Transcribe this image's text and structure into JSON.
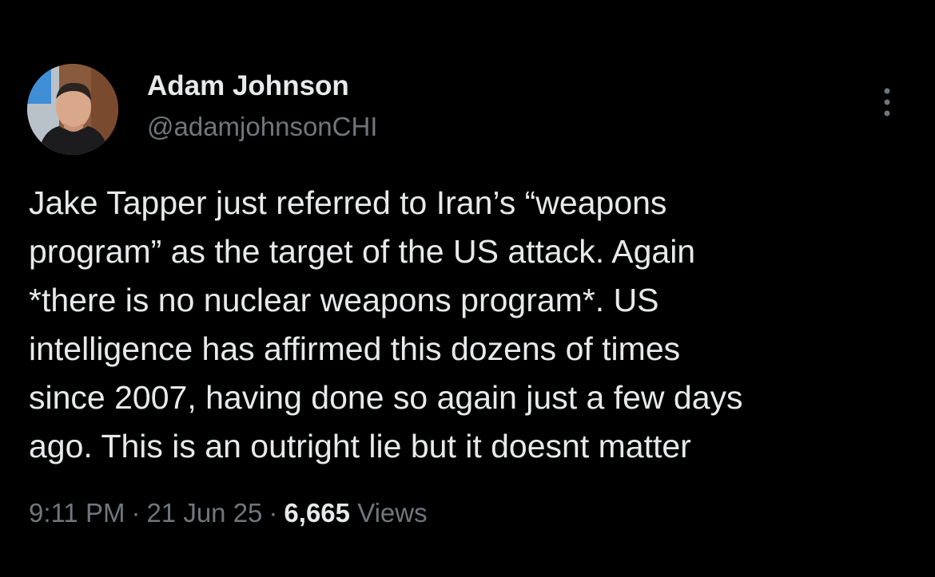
{
  "author": {
    "display_name": "Adam Johnson",
    "handle": "@adamjohnsonCHI",
    "avatar_icon": "profile-photo"
  },
  "tweet": {
    "text": "Jake Tapper just referred to Iran’s “weapons\nprogram” as the target of the US attack. Again\n*there is no nuclear weapons program*. US\nintelligence has affirmed this dozens of times\nsince 2007, having done so again just a few days\nago. This is an outright lie but it doesnt matter"
  },
  "meta": {
    "time": "9:11 PM",
    "separator": "·",
    "date": "21 Jun 25",
    "views_count": "6,665",
    "views_label": "Views"
  },
  "icons": {
    "more": "more-options-icon"
  },
  "colors": {
    "background": "#000000",
    "primary_text": "#e7e9ea",
    "secondary_text": "#71767b"
  }
}
